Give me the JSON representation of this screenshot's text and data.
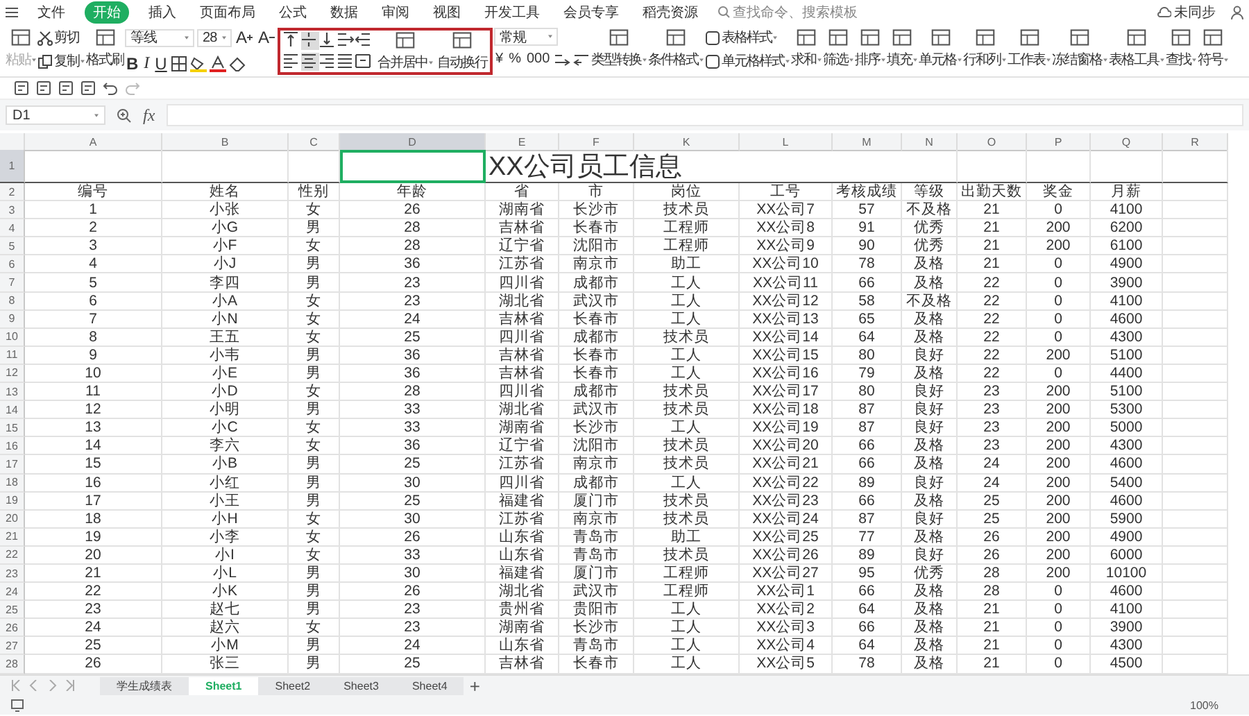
{
  "menu": {
    "items": [
      {
        "label": "文件",
        "selected": false
      },
      {
        "label": "开始",
        "selected": true
      },
      {
        "label": "插入",
        "selected": false
      },
      {
        "label": "页面布局",
        "selected": false
      },
      {
        "label": "公式",
        "selected": false
      },
      {
        "label": "数据",
        "selected": false
      },
      {
        "label": "审阅",
        "selected": false
      },
      {
        "label": "视图",
        "selected": false
      },
      {
        "label": "开发工具",
        "selected": false
      },
      {
        "label": "会员专享",
        "selected": false
      },
      {
        "label": "稻壳资源",
        "selected": false
      }
    ],
    "search": {
      "placeholder": "查找命令、搜索模板"
    },
    "sync_status": "未同步"
  },
  "ribbon": {
    "paste": {
      "label": "粘贴",
      "disabled": true
    },
    "clipboard": [
      "剪切",
      "复制"
    ],
    "format_painter": "格式刷",
    "font": {
      "family": "等线",
      "size": "28",
      "grow": "A",
      "shrink": "A",
      "styles": [
        "B",
        "I",
        "U"
      ]
    },
    "alignment": {
      "icons": [
        {
          "selected": false
        },
        {
          "selected": true
        },
        {
          "selected": false
        },
        {
          "selected": false
        },
        {
          "selected": false
        },
        {
          "selected": false
        },
        {
          "selected": true
        },
        {
          "selected": false
        },
        {
          "selected": false
        },
        {
          "selected": false
        }
      ],
      "merge": "合并居中",
      "wrap": "自动换行"
    },
    "number": {
      "format": "常规",
      "symbols": [
        "¥",
        "%",
        "000"
      ]
    },
    "buttons": [
      {
        "kind": "big",
        "label": "类型转换"
      },
      {
        "kind": "big",
        "label": "条件格式"
      },
      {
        "kind": "stack",
        "labels": [
          "表格样式",
          "单元格样式"
        ]
      },
      {
        "kind": "big",
        "label": "求和"
      },
      {
        "kind": "big",
        "label": "筛选"
      },
      {
        "kind": "big",
        "label": "排序"
      },
      {
        "kind": "big",
        "label": "填充"
      },
      {
        "kind": "big",
        "label": "单元格"
      },
      {
        "kind": "big",
        "label": "行和列"
      },
      {
        "kind": "big",
        "label": "工作表"
      },
      {
        "kind": "big",
        "label": "冻结窗格"
      },
      {
        "kind": "big",
        "label": "表格工具"
      },
      {
        "kind": "big",
        "label": "查找"
      },
      {
        "kind": "big",
        "label": "符号"
      }
    ]
  },
  "name_box": "D1",
  "formula_label": "fx",
  "columns": [
    {
      "label": "A",
      "selected": false
    },
    {
      "label": "B",
      "selected": false
    },
    {
      "label": "C",
      "selected": false
    },
    {
      "label": "D",
      "selected": true
    },
    {
      "label": "E",
      "selected": false
    },
    {
      "label": "F",
      "selected": false
    },
    {
      "label": "K",
      "selected": false
    },
    {
      "label": "L",
      "selected": false
    },
    {
      "label": "M",
      "selected": false
    },
    {
      "label": "N",
      "selected": false
    },
    {
      "label": "O",
      "selected": false
    },
    {
      "label": "P",
      "selected": false
    },
    {
      "label": "Q",
      "selected": false
    },
    {
      "label": "R",
      "selected": false
    }
  ],
  "title_row": {
    "number": "1",
    "title": "XX公司员工信息"
  },
  "rows": [
    {
      "number": "2",
      "cells": [
        "编号",
        "姓名",
        "性别",
        "年龄",
        "省",
        "市",
        "岗位",
        "工号",
        "考核成绩",
        "等级",
        "出勤天数",
        "奖金",
        "月薪"
      ]
    },
    {
      "number": "3",
      "cells": [
        "1",
        "小张",
        "女",
        "26",
        "湖南省",
        "长沙市",
        "技术员",
        "XX公司7",
        "57",
        "不及格",
        "21",
        "0",
        "4100"
      ]
    },
    {
      "number": "4",
      "cells": [
        "2",
        "小G",
        "男",
        "28",
        "吉林省",
        "长春市",
        "工程师",
        "XX公司8",
        "91",
        "优秀",
        "21",
        "200",
        "6200"
      ]
    },
    {
      "number": "5",
      "cells": [
        "3",
        "小F",
        "女",
        "28",
        "辽宁省",
        "沈阳市",
        "工程师",
        "XX公司9",
        "90",
        "优秀",
        "21",
        "200",
        "6100"
      ]
    },
    {
      "number": "6",
      "cells": [
        "4",
        "小J",
        "男",
        "36",
        "江苏省",
        "南京市",
        "助工",
        "XX公司10",
        "78",
        "及格",
        "21",
        "0",
        "4900"
      ]
    },
    {
      "number": "7",
      "cells": [
        "5",
        "李四",
        "男",
        "23",
        "四川省",
        "成都市",
        "工人",
        "XX公司11",
        "66",
        "及格",
        "22",
        "0",
        "3900"
      ]
    },
    {
      "number": "8",
      "cells": [
        "6",
        "小A",
        "女",
        "23",
        "湖北省",
        "武汉市",
        "工人",
        "XX公司12",
        "58",
        "不及格",
        "22",
        "0",
        "4100"
      ]
    },
    {
      "number": "9",
      "cells": [
        "7",
        "小N",
        "女",
        "24",
        "吉林省",
        "长春市",
        "工人",
        "XX公司13",
        "65",
        "及格",
        "22",
        "0",
        "4600"
      ]
    },
    {
      "number": "10",
      "cells": [
        "8",
        "王五",
        "女",
        "25",
        "四川省",
        "成都市",
        "技术员",
        "XX公司14",
        "64",
        "及格",
        "22",
        "0",
        "4300"
      ]
    },
    {
      "number": "11",
      "cells": [
        "9",
        "小韦",
        "男",
        "36",
        "吉林省",
        "长春市",
        "工人",
        "XX公司15",
        "80",
        "良好",
        "22",
        "200",
        "5100"
      ]
    },
    {
      "number": "12",
      "cells": [
        "10",
        "小E",
        "男",
        "36",
        "吉林省",
        "长春市",
        "工人",
        "XX公司16",
        "79",
        "及格",
        "22",
        "0",
        "4400"
      ]
    },
    {
      "number": "13",
      "cells": [
        "11",
        "小D",
        "女",
        "28",
        "四川省",
        "成都市",
        "技术员",
        "XX公司17",
        "80",
        "良好",
        "23",
        "200",
        "5100"
      ]
    },
    {
      "number": "14",
      "cells": [
        "12",
        "小明",
        "男",
        "33",
        "湖北省",
        "武汉市",
        "技术员",
        "XX公司18",
        "87",
        "良好",
        "23",
        "200",
        "5300"
      ]
    },
    {
      "number": "15",
      "cells": [
        "13",
        "小C",
        "女",
        "33",
        "湖南省",
        "长沙市",
        "工人",
        "XX公司19",
        "87",
        "良好",
        "23",
        "200",
        "5000"
      ]
    },
    {
      "number": "16",
      "cells": [
        "14",
        "李六",
        "女",
        "36",
        "辽宁省",
        "沈阳市",
        "技术员",
        "XX公司20",
        "66",
        "及格",
        "23",
        "200",
        "4300"
      ]
    },
    {
      "number": "17",
      "cells": [
        "15",
        "小B",
        "男",
        "25",
        "江苏省",
        "南京市",
        "技术员",
        "XX公司21",
        "66",
        "及格",
        "24",
        "200",
        "4600"
      ]
    },
    {
      "number": "18",
      "cells": [
        "16",
        "小红",
        "男",
        "30",
        "四川省",
        "成都市",
        "工人",
        "XX公司22",
        "89",
        "良好",
        "24",
        "200",
        "5400"
      ]
    },
    {
      "number": "19",
      "cells": [
        "17",
        "小王",
        "男",
        "25",
        "福建省",
        "厦门市",
        "技术员",
        "XX公司23",
        "66",
        "及格",
        "25",
        "200",
        "4600"
      ]
    },
    {
      "number": "20",
      "cells": [
        "18",
        "小H",
        "女",
        "30",
        "江苏省",
        "南京市",
        "技术员",
        "XX公司24",
        "87",
        "良好",
        "25",
        "200",
        "5900"
      ]
    },
    {
      "number": "21",
      "cells": [
        "19",
        "小李",
        "女",
        "26",
        "山东省",
        "青岛市",
        "助工",
        "XX公司25",
        "77",
        "及格",
        "26",
        "200",
        "4900"
      ]
    },
    {
      "number": "22",
      "cells": [
        "20",
        "小I",
        "女",
        "33",
        "山东省",
        "青岛市",
        "技术员",
        "XX公司26",
        "89",
        "良好",
        "26",
        "200",
        "6000"
      ]
    },
    {
      "number": "23",
      "cells": [
        "21",
        "小L",
        "男",
        "30",
        "福建省",
        "厦门市",
        "工程师",
        "XX公司27",
        "95",
        "优秀",
        "28",
        "200",
        "10100"
      ]
    },
    {
      "number": "24",
      "cells": [
        "22",
        "小K",
        "男",
        "26",
        "湖北省",
        "武汉市",
        "工程师",
        "XX公司1",
        "66",
        "及格",
        "28",
        "0",
        "4600"
      ]
    },
    {
      "number": "25",
      "cells": [
        "23",
        "赵七",
        "男",
        "23",
        "贵州省",
        "贵阳市",
        "工人",
        "XX公司2",
        "64",
        "及格",
        "21",
        "0",
        "4100"
      ]
    },
    {
      "number": "26",
      "cells": [
        "24",
        "赵六",
        "女",
        "23",
        "湖南省",
        "长沙市",
        "工人",
        "XX公司3",
        "66",
        "及格",
        "21",
        "0",
        "3900"
      ]
    },
    {
      "number": "27",
      "cells": [
        "25",
        "小M",
        "男",
        "24",
        "山东省",
        "青岛市",
        "工人",
        "XX公司4",
        "64",
        "及格",
        "21",
        "0",
        "4300"
      ]
    },
    {
      "number": "28",
      "cells": [
        "26",
        "张三",
        "男",
        "25",
        "吉林省",
        "长春市",
        "工人",
        "XX公司5",
        "78",
        "及格",
        "21",
        "0",
        "4500"
      ]
    }
  ],
  "sheet_tabs": [
    {
      "label": "学生成绩表",
      "selected": false
    },
    {
      "label": "Sheet1",
      "selected": true
    },
    {
      "label": "Sheet2",
      "selected": false
    },
    {
      "label": "Sheet3",
      "selected": false
    },
    {
      "label": "Sheet4",
      "selected": false
    }
  ],
  "add_sheet": "+",
  "zoom": "100%"
}
